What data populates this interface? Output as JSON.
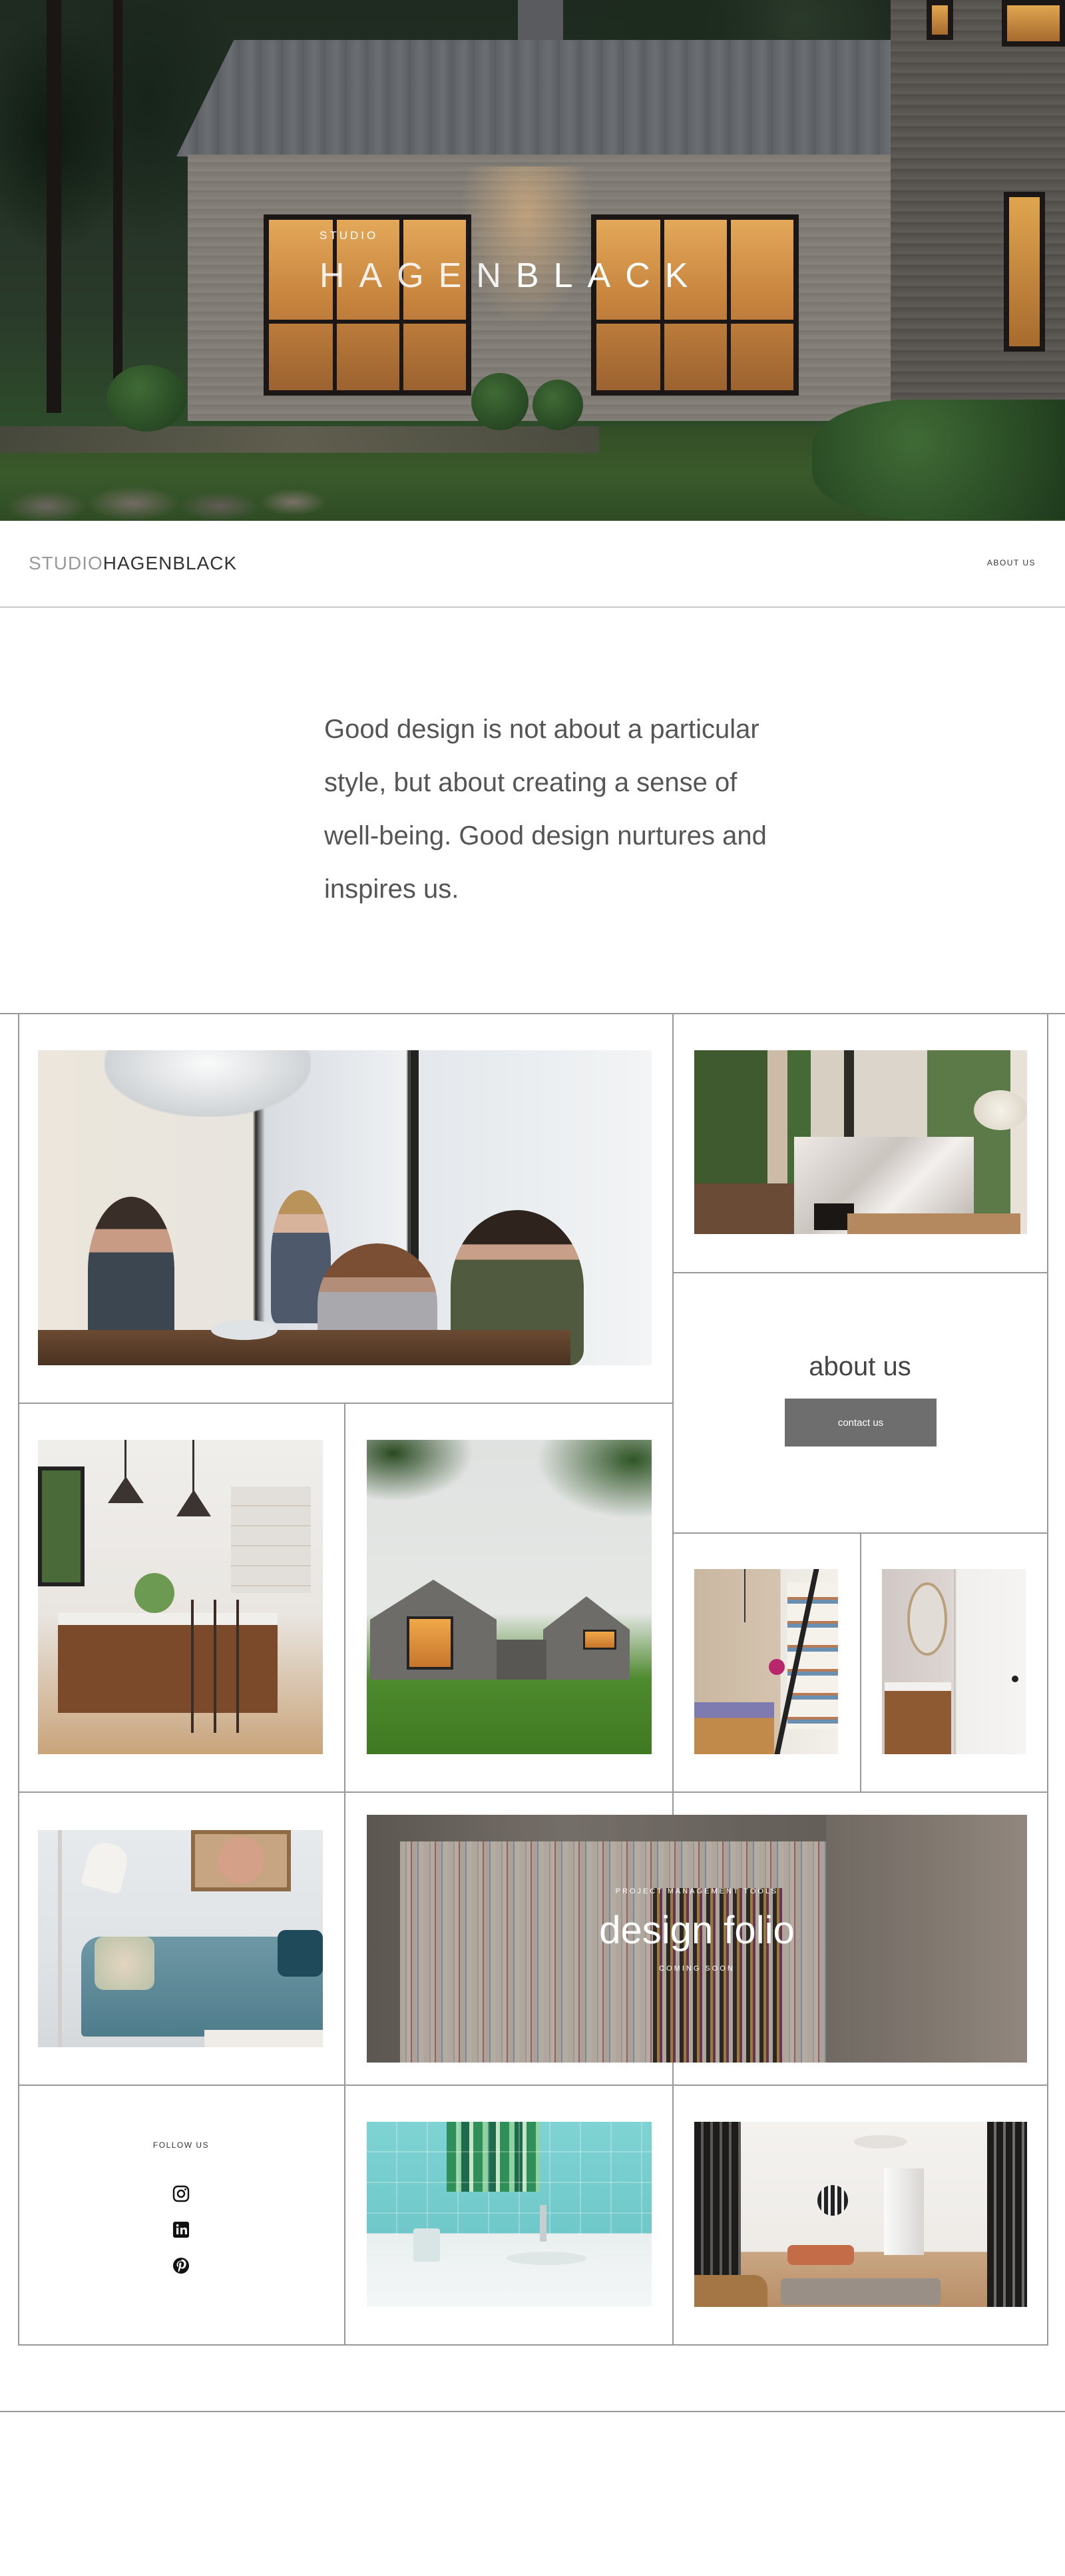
{
  "hero": {
    "studio": "STUDIO",
    "brand_light": "HAGEN",
    "brand_bold": "BLACK"
  },
  "nav": {
    "logo_studio": "STUDIO",
    "logo_brand": "HAGENBLACK",
    "about_link": "ABOUT US"
  },
  "quote": "Good design is not about a particular style, but about creating a sense of well-being. Good design nurtures and inspires us.",
  "about": {
    "title": "about us",
    "contact_button": "contact us"
  },
  "folio": {
    "kicker": "PROJECT MANAGEMENT TOOLS",
    "title": "design folio",
    "subtitle": "COMING SOON"
  },
  "social": {
    "label": "FOLLOW US",
    "icons": [
      "instagram-icon",
      "linkedin-icon",
      "pinterest-icon"
    ]
  },
  "colors": {
    "accent_gray": "#6e6e6e",
    "divider": "#999999"
  }
}
